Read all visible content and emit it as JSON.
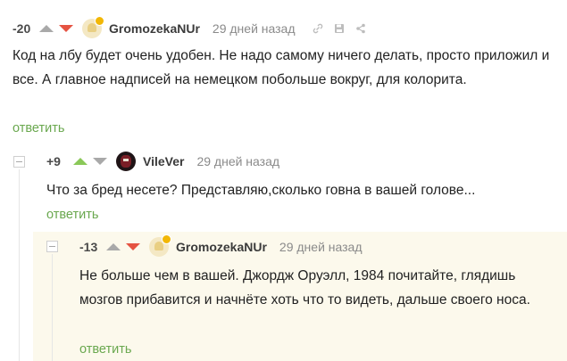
{
  "comments": [
    {
      "rating": "-20",
      "author": "GromozekaNUr",
      "time": "29 дней назад",
      "text": "Код на лбу будет очень удобен. Не надо самому ничего делать, просто приложил и все. А главное надписей на немецком побольше вокруг, для колорита.",
      "reply": "ответить",
      "vote": "down"
    },
    {
      "rating": "+9",
      "author": "VileVer",
      "time": "29 дней назад",
      "text": "Что за бред несете? Представляю,сколько говна в вашей голове...",
      "reply": "ответить",
      "vote": "up"
    },
    {
      "rating": "-13",
      "author": "GromozekaNUr",
      "time": "29 дней назад",
      "text": "Не больше чем в вашей. Джордж Оруэлл, 1984 почитайте, глядишь мозгов прибавится и начнёте хоть что то видеть, дальше своего носа.",
      "reply": "ответить",
      "vote": "down"
    }
  ],
  "colors": {
    "reply_link": "#6aa84f",
    "upvote_active": "#8ac858",
    "downvote_active": "#e55342",
    "highlight_background": "#fcf9ec"
  }
}
